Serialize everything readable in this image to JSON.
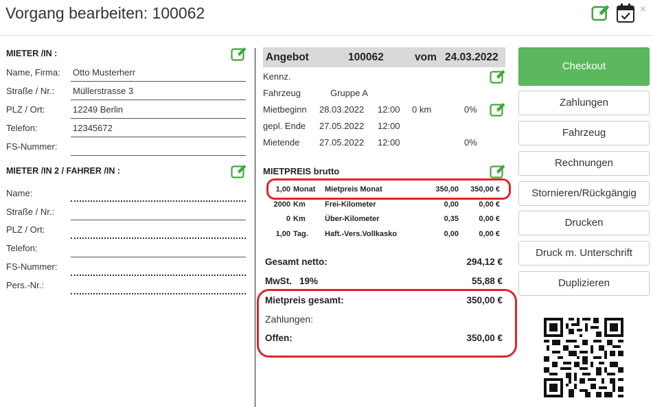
{
  "header": {
    "title": "Vorgang bearbeiten: 100062",
    "close_glyph": "×",
    "icons": [
      "edit-icon",
      "calendar-check-icon",
      "close-icon"
    ]
  },
  "colors": {
    "accent_green": "#5cb85c",
    "icon_green": "#3fa63f",
    "highlight_red": "#e0232b",
    "header_gray": "#d9d9d9"
  },
  "tenant1": {
    "title": "MIETER /IN :",
    "rows": [
      {
        "label": "Name, Firma:",
        "value": "Otto Musterherr"
      },
      {
        "label": "Straße / Nr.:",
        "value": "Müllerstrasse 3"
      },
      {
        "label": "PLZ / Ort:",
        "value": "12249 Berlin"
      },
      {
        "label": "Telefon:",
        "value": "12345672"
      },
      {
        "label": "FS-Nummer:",
        "value": ""
      }
    ]
  },
  "tenant2": {
    "title": "MIETER /IN 2 / FAHRER /IN :",
    "rows": [
      {
        "label": "Name:",
        "value": ""
      },
      {
        "label": "Straße / Nr.:",
        "value": ""
      },
      {
        "label": "PLZ / Ort:",
        "value": ""
      },
      {
        "label": "Telefon:",
        "value": ""
      },
      {
        "label": "FS-Nummer:",
        "value": ""
      },
      {
        "label": "Pers.-Nr.:",
        "value": ""
      }
    ]
  },
  "offer": {
    "type": "Angebot",
    "number": "100062",
    "date_prefix": "vom",
    "date": "24.03.2022",
    "kennz_label": "Kennz.",
    "vehicle_label": "Fahrzeug",
    "vehicle_group": "Gruppe A",
    "start": {
      "label": "Mietbeginn",
      "date": "28.03.2022",
      "time": "12:00",
      "km": "0 km",
      "pct": "0%"
    },
    "planned_end": {
      "label": "gepl. Ende",
      "date": "27.05.2022",
      "time": "12:00"
    },
    "end": {
      "label": "Mietende",
      "date": "27.05.2022",
      "time": "12:00",
      "pct": "0%"
    }
  },
  "pricing": {
    "title": "MIETPREIS brutto",
    "rows": [
      {
        "qty": "1,00",
        "unit": "Monat",
        "desc": "Mietpreis Monat",
        "price": "350,00",
        "total": "350,00 €"
      },
      {
        "qty": "2000",
        "unit": "Km",
        "desc": "Frei-Kilometer",
        "price": "0,00",
        "total": "0,00 €"
      },
      {
        "qty": "0",
        "unit": "Km",
        "desc": "Über-Kilometer",
        "price": "0,35",
        "total": "0,00 €"
      },
      {
        "qty": "1,00",
        "unit": "Tag.",
        "desc": "Haft.-Vers.Vollkasko",
        "price": "0,00",
        "total": "0,00 €"
      }
    ],
    "net_label": "Gesamt netto:",
    "net_value": "294,12 €",
    "vat_label": "MwSt.",
    "vat_rate": "19%",
    "vat_value": "55,88 €",
    "gross_label": "Mietpreis gesamt:",
    "gross_value": "350,00 €",
    "payments_label": "Zahlungen:",
    "open_label": "Offen:",
    "open_value": "350,00 €"
  },
  "actions": [
    "Checkout",
    "Zahlungen",
    "Fahrzeug",
    "Rechnungen",
    "Stornieren/Rückgängig",
    "Drucken",
    "Druck m. Unterschrift",
    "Duplizieren"
  ]
}
